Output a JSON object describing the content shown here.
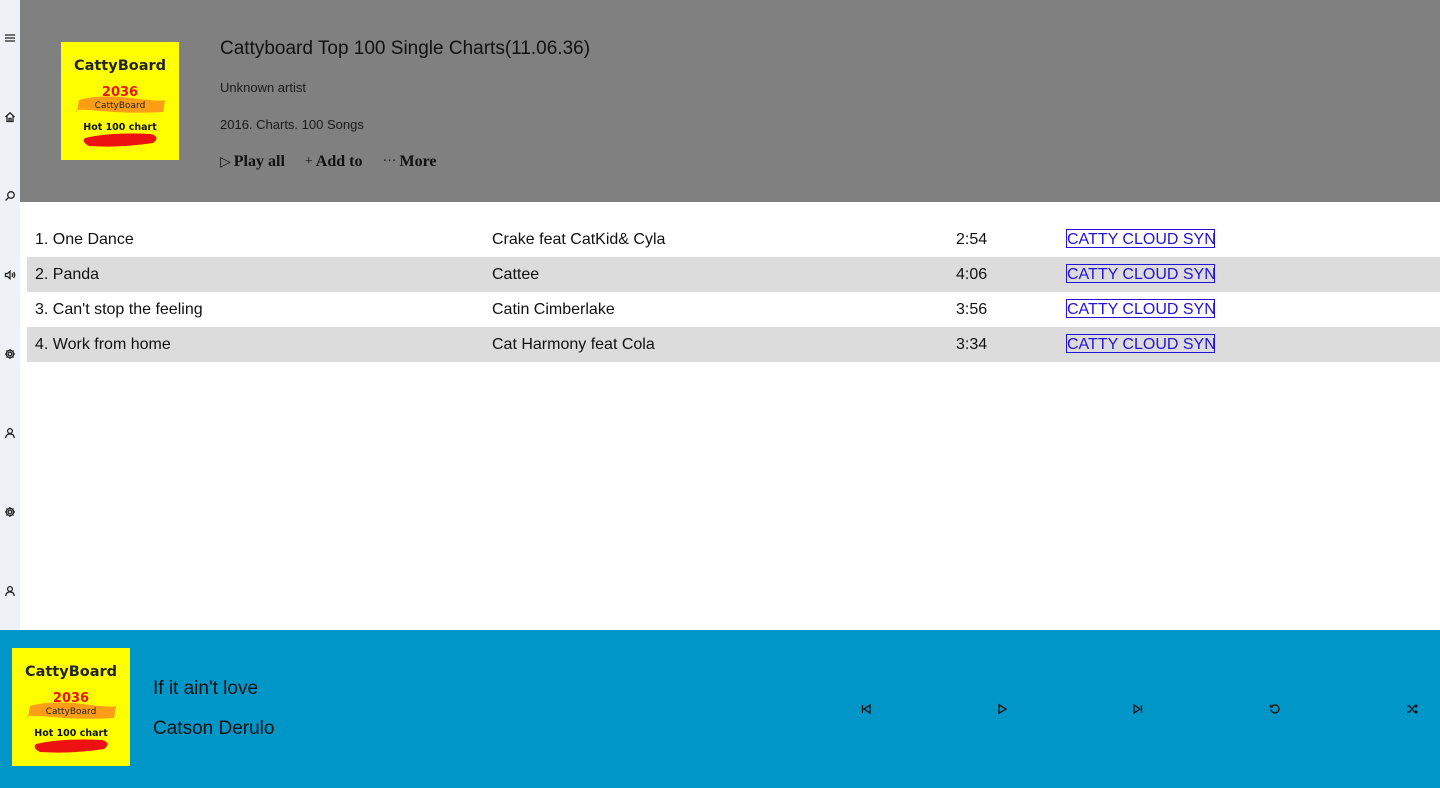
{
  "rail": {
    "icons": [
      "menu-icon",
      "home-icon",
      "search-icon",
      "volume-icon",
      "settings-icon",
      "user-icon",
      "settings-icon",
      "user-icon"
    ]
  },
  "header": {
    "background": "#808080",
    "album_art": {
      "brand": "CattyBoard",
      "year": "2036",
      "sub_brand": "CattyBoard",
      "caption": "Hot 100 chart",
      "background": "#ffff00"
    },
    "title": "Cattyboard Top 100 Single Charts(11.06.36)",
    "artist": "Unknown artist",
    "meta": "2016. Charts. 100 Songs",
    "actions": {
      "play_all": {
        "glyph": "▷",
        "label": "Play all"
      },
      "add_to": {
        "glyph": "+",
        "label": "Add to"
      },
      "more": {
        "glyph": "···",
        "label": "More"
      }
    }
  },
  "tracks": [
    {
      "title": "1. One Dance",
      "artist": "Crake feat CatKid& Cyla",
      "duration": "2:54",
      "action": "CATTY CLOUD SYNC"
    },
    {
      "title": "2. Panda",
      "artist": "Cattee",
      "duration": "4:06",
      "action": "CATTY CLOUD SYNC"
    },
    {
      "title": "3. Can't stop the feeling",
      "artist": "Catin Cimberlake",
      "duration": "3:56",
      "action": "CATTY CLOUD SYNC"
    },
    {
      "title": "4. Work from home",
      "artist": "Cat Harmony feat Cola",
      "duration": "3:34",
      "action": "CATTY CLOUD SYNC"
    }
  ],
  "player": {
    "background": "#0096c7",
    "now_playing": {
      "title": "If it ain't love",
      "artist": "Catson Derulo"
    },
    "album_art": {
      "brand": "CattyBoard",
      "year": "2036",
      "sub_brand": "CattyBoard",
      "caption": "Hot 100 chart"
    },
    "controls": [
      "previous-icon",
      "play-icon",
      "next-icon",
      "repeat-icon",
      "shuffle-icon"
    ]
  }
}
